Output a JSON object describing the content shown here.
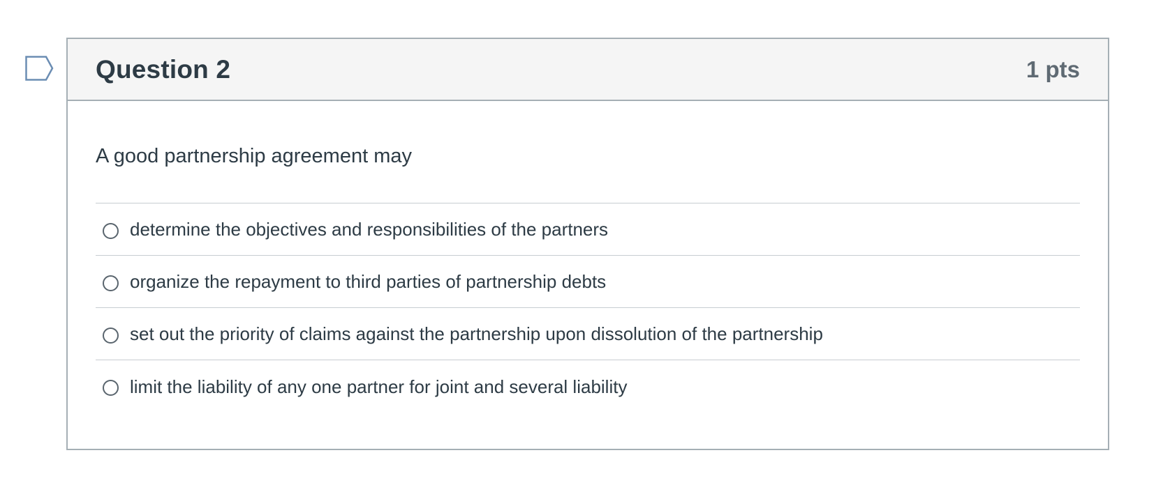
{
  "question": {
    "title": "Question 2",
    "points": "1 pts",
    "text": "A good partnership agreement may",
    "answers": [
      {
        "label": "determine the objectives and responsibilities of the partners",
        "selected": false
      },
      {
        "label": "organize the repayment to third parties of partnership debts",
        "selected": false
      },
      {
        "label": "set out the priority of claims against the partnership upon dissolution of the partnership",
        "selected": false
      },
      {
        "label": "limit the liability of any one partner for joint and several liability",
        "selected": false
      }
    ]
  },
  "icons": {
    "flag": "flag-question-icon"
  },
  "colors": {
    "text": "#2d3b45",
    "points": "#5f6a73",
    "border": "#a5afb5",
    "header_bg": "#f5f5f5",
    "flag": "#6b8db3"
  }
}
